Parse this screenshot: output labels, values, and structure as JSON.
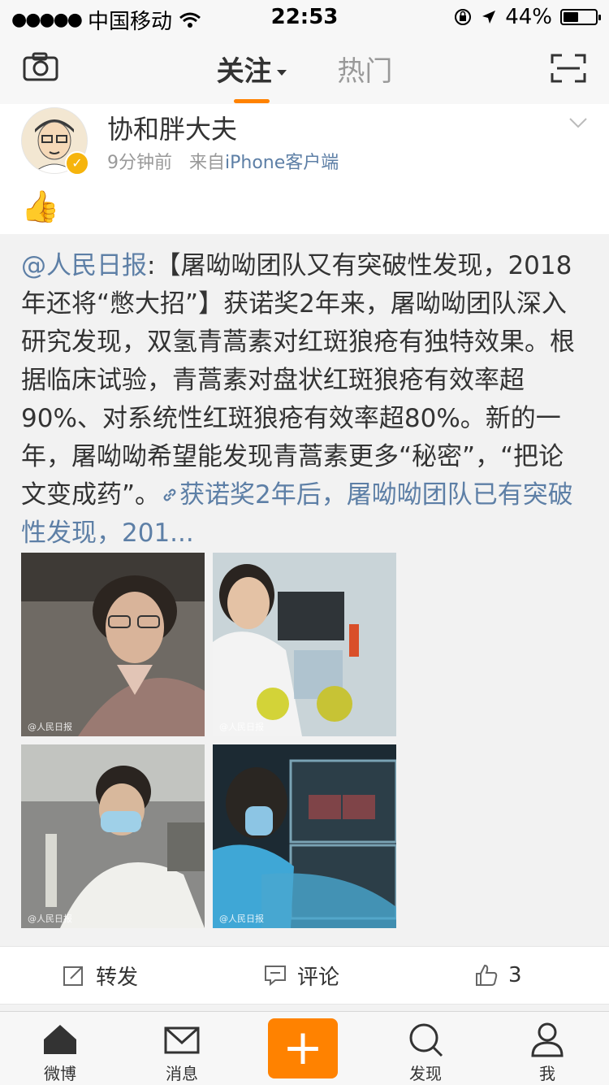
{
  "status": {
    "carrier": "中国移动",
    "time": "22:53",
    "battery": "44%"
  },
  "nav": {
    "tab_follow": "关注",
    "tab_hot": "热门"
  },
  "post": {
    "username": "协和胖大夫",
    "time_ago": "9分钟前",
    "source_prefix": "来自",
    "source": "iPhone客户端",
    "emoji": "👍"
  },
  "repost": {
    "mention": "@人民日报",
    "text": ":【屠呦呦团队又有突破性发现，2018年还将“憋大招”】获诺奖2年来，屠呦呦团队深入研究发现，双氢青蒿素对红斑狼疮有独特效果。根据临床试验，青蒿素对盘状红斑狼疮有效率超90%、对系统性红斑狼疮有效率超80%。新的一年，屠呦呦希望能发现青蒿素更多“秘密”，“把论文变成药”。",
    "link_text": "获诺奖2年后，屠呦呦团队已有突破性发现，201...",
    "images": [
      {
        "watermark": "@人民日报"
      },
      {
        "watermark": "@人民日报"
      },
      {
        "watermark": "@人民日报"
      },
      {
        "watermark": "@人民日报"
      }
    ]
  },
  "actions": {
    "repost_label": "转发",
    "comment_label": "评论",
    "like_count": "3"
  },
  "tabbar": {
    "home": "微博",
    "messages": "消息",
    "discover": "发现",
    "me": "我"
  },
  "colors": {
    "accent": "#ff8200",
    "link": "#5d7fa6"
  }
}
